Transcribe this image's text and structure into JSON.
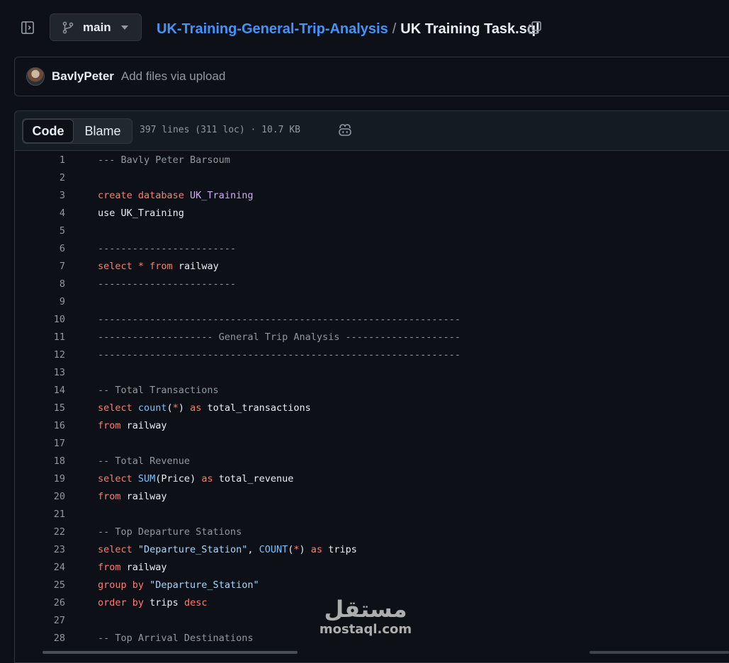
{
  "header": {
    "branch": "main",
    "repo": "UK-Training-General-Trip-Analysis",
    "separator": "/",
    "file": "UK Training Task.sql"
  },
  "commit": {
    "author": "BavlyPeter",
    "message": "Add files via upload"
  },
  "file_header": {
    "tab_code": "Code",
    "tab_blame": "Blame",
    "stats": "397 lines (311 loc) · 10.7 KB"
  },
  "code_lines": [
    {
      "n": "1",
      "tokens": [
        {
          "c": "tk-com",
          "t": "--- Bavly Peter Barsoum"
        }
      ]
    },
    {
      "n": "2",
      "tokens": []
    },
    {
      "n": "3",
      "tokens": [
        {
          "c": "tk-kw",
          "t": "create database "
        },
        {
          "c": "tk-id",
          "t": "UK_Training"
        }
      ]
    },
    {
      "n": "4",
      "tokens": [
        {
          "c": "tk-pl",
          "t": "use UK_Training"
        }
      ]
    },
    {
      "n": "5",
      "tokens": []
    },
    {
      "n": "6",
      "tokens": [
        {
          "c": "tk-com",
          "t": "------------------------"
        }
      ]
    },
    {
      "n": "7",
      "tokens": [
        {
          "c": "tk-kw",
          "t": "select "
        },
        {
          "c": "tk-kw",
          "t": "* "
        },
        {
          "c": "tk-kw",
          "t": "from "
        },
        {
          "c": "tk-pl",
          "t": "railway"
        }
      ]
    },
    {
      "n": "8",
      "tokens": [
        {
          "c": "tk-com",
          "t": "------------------------"
        }
      ]
    },
    {
      "n": "9",
      "tokens": []
    },
    {
      "n": "10",
      "tokens": [
        {
          "c": "tk-com",
          "t": "---------------------------------------------------------------"
        }
      ]
    },
    {
      "n": "11",
      "tokens": [
        {
          "c": "tk-com",
          "t": "-------------------- General Trip Analysis --------------------"
        }
      ]
    },
    {
      "n": "12",
      "tokens": [
        {
          "c": "tk-com",
          "t": "---------------------------------------------------------------"
        }
      ]
    },
    {
      "n": "13",
      "tokens": []
    },
    {
      "n": "14",
      "tokens": [
        {
          "c": "tk-com",
          "t": "-- Total Transactions"
        }
      ]
    },
    {
      "n": "15",
      "tokens": [
        {
          "c": "tk-kw",
          "t": "select "
        },
        {
          "c": "tk-fn",
          "t": "count"
        },
        {
          "c": "tk-pl",
          "t": "("
        },
        {
          "c": "tk-kw",
          "t": "*"
        },
        {
          "c": "tk-pl",
          "t": ") "
        },
        {
          "c": "tk-kw",
          "t": "as "
        },
        {
          "c": "tk-pl",
          "t": "total_transactions"
        }
      ]
    },
    {
      "n": "16",
      "tokens": [
        {
          "c": "tk-kw",
          "t": "from "
        },
        {
          "c": "tk-pl",
          "t": "railway"
        }
      ]
    },
    {
      "n": "17",
      "tokens": []
    },
    {
      "n": "18",
      "tokens": [
        {
          "c": "tk-com",
          "t": "-- Total Revenue"
        }
      ]
    },
    {
      "n": "19",
      "tokens": [
        {
          "c": "tk-kw",
          "t": "select "
        },
        {
          "c": "tk-fn",
          "t": "SUM"
        },
        {
          "c": "tk-pl",
          "t": "(Price) "
        },
        {
          "c": "tk-kw",
          "t": "as "
        },
        {
          "c": "tk-pl",
          "t": "total_revenue"
        }
      ]
    },
    {
      "n": "20",
      "tokens": [
        {
          "c": "tk-kw",
          "t": "from "
        },
        {
          "c": "tk-pl",
          "t": "railway"
        }
      ]
    },
    {
      "n": "21",
      "tokens": []
    },
    {
      "n": "22",
      "tokens": [
        {
          "c": "tk-com",
          "t": "-- Top Departure Stations"
        }
      ]
    },
    {
      "n": "23",
      "tokens": [
        {
          "c": "tk-kw",
          "t": "select "
        },
        {
          "c": "tk-str",
          "t": "\"Departure_Station\""
        },
        {
          "c": "tk-pl",
          "t": ", "
        },
        {
          "c": "tk-fn",
          "t": "COUNT"
        },
        {
          "c": "tk-pl",
          "t": "("
        },
        {
          "c": "tk-kw",
          "t": "*"
        },
        {
          "c": "tk-pl",
          "t": ") "
        },
        {
          "c": "tk-kw",
          "t": "as "
        },
        {
          "c": "tk-pl",
          "t": "trips"
        }
      ]
    },
    {
      "n": "24",
      "tokens": [
        {
          "c": "tk-kw",
          "t": "from "
        },
        {
          "c": "tk-pl",
          "t": "railway"
        }
      ]
    },
    {
      "n": "25",
      "tokens": [
        {
          "c": "tk-kw",
          "t": "group by "
        },
        {
          "c": "tk-str",
          "t": "\"Departure_Station\""
        }
      ]
    },
    {
      "n": "26",
      "tokens": [
        {
          "c": "tk-kw",
          "t": "order by "
        },
        {
          "c": "tk-pl",
          "t": "trips "
        },
        {
          "c": "tk-kw",
          "t": "desc"
        }
      ]
    },
    {
      "n": "27",
      "tokens": []
    },
    {
      "n": "28",
      "tokens": [
        {
          "c": "tk-com",
          "t": "-- Top Arrival Destinations"
        }
      ]
    }
  ],
  "watermark": {
    "arabic": "مستقل",
    "latin": "mostaql.com"
  },
  "colors": {
    "background": "#0d1117",
    "link": "#4493f8",
    "keyword": "#ff7b72",
    "comment": "#9198a1",
    "identifier": "#d2a8ff",
    "function": "#79c0ff",
    "string": "#a5d6ff"
  },
  "icons": [
    "sidebar-toggle-icon",
    "git-branch-icon",
    "chevron-down-icon",
    "copy-icon",
    "copilot-icon"
  ]
}
